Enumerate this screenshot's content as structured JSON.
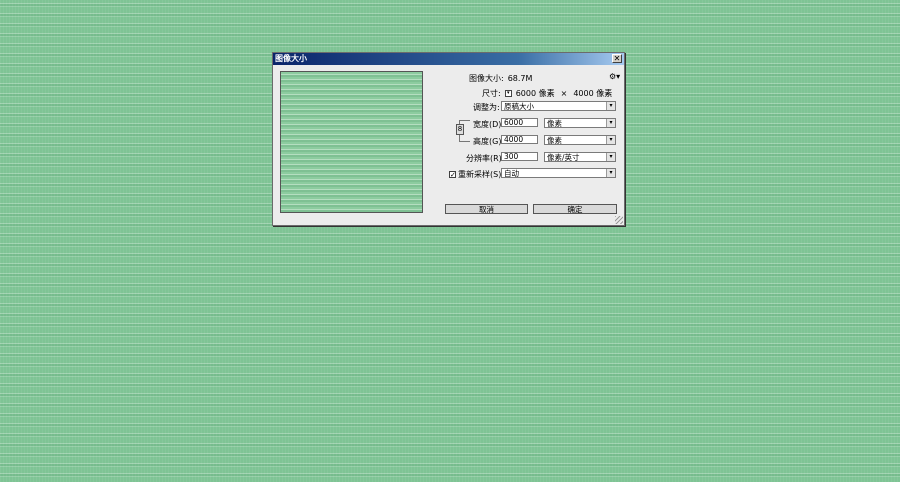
{
  "dialog": {
    "title": "图像大小",
    "image_size_label": "图像大小:",
    "image_size_value": "68.7M",
    "dimensions_label": "尺寸:",
    "dimensions_width": "6000 像素",
    "dimensions_times": "×",
    "dimensions_height": "4000 像素",
    "fit_to_label": "调整为:",
    "fit_to_value": "原稿大小",
    "width_label": "宽度(D):",
    "width_value": "6000",
    "width_unit": "像素",
    "height_label": "高度(G):",
    "height_value": "4000",
    "height_unit": "像素",
    "resolution_label": "分辨率(R):",
    "resolution_value": "300",
    "resolution_unit": "像素/英寸",
    "resample_label": "重新采样(S):",
    "resample_checked": true,
    "resample_value": "自动",
    "cancel_label": "取消",
    "ok_label": "确定"
  },
  "colors": {
    "background": "#7fc495",
    "titlebar_start": "#0a246a",
    "titlebar_end": "#a6caf0",
    "dialog_bg": "#ececec"
  }
}
